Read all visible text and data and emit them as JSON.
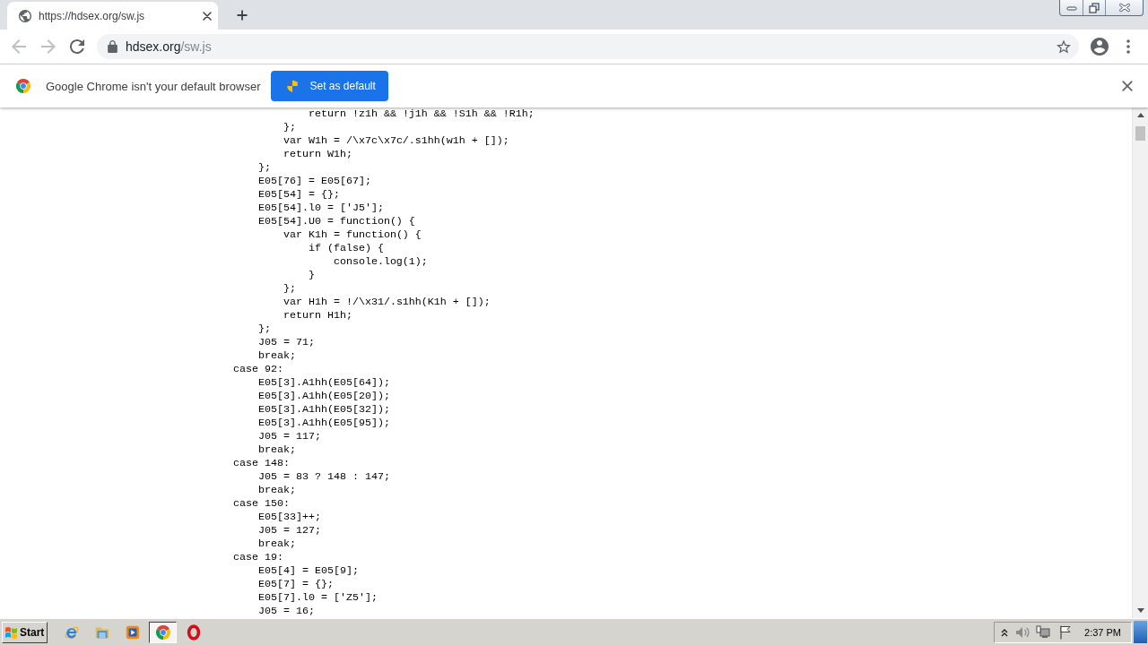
{
  "tabs": [
    {
      "title": "https://hdsex.org/sw.js",
      "selected": true
    }
  ],
  "toolbar": {
    "back": {
      "disabled": true
    },
    "forward": {
      "disabled": true
    },
    "address": {
      "host": "hdsex.org",
      "path": "/sw.js"
    }
  },
  "infobar": {
    "message": "Google Chrome isn't your default browser",
    "button": "Set as default"
  },
  "code": {
    "lines": [
      "            return !z1h && !j1h && !S1h && !R1h;",
      "        };",
      "        var W1h = /\\x7c\\x7c/.s1hh(w1h + []);",
      "        return W1h;",
      "    };",
      "    E05[76] = E05[67];",
      "    E05[54] = {};",
      "    E05[54].l0 = ['J5'];",
      "    E05[54].U0 = function() {",
      "        var K1h = function() {",
      "            if (false) {",
      "                console.log(1);",
      "            }",
      "        };",
      "        var H1h = !/\\x31/.s1hh(K1h + []);",
      "        return H1h;",
      "    };",
      "    J05 = 71;",
      "    break;",
      "case 92:",
      "    E05[3].A1hh(E05[64]);",
      "    E05[3].A1hh(E05[20]);",
      "    E05[3].A1hh(E05[32]);",
      "    E05[3].A1hh(E05[95]);",
      "    J05 = 117;",
      "    break;",
      "case 148:",
      "    J05 = 83 ? 148 : 147;",
      "    break;",
      "case 150:",
      "    E05[33]++;",
      "    J05 = 127;",
      "    break;",
      "case 19:",
      "    E05[4] = E05[9];",
      "    E05[7] = {};",
      "    E05[7].l0 = ['Z5'];",
      "    J05 = 16;"
    ]
  },
  "taskbar": {
    "start": "Start",
    "apps": [
      {
        "kind": "ie",
        "selected": false
      },
      {
        "kind": "folder",
        "selected": false
      },
      {
        "kind": "media",
        "selected": false
      },
      {
        "kind": "chrome",
        "selected": true
      },
      {
        "kind": "opera",
        "selected": false
      }
    ],
    "clock": "2:37 PM"
  }
}
